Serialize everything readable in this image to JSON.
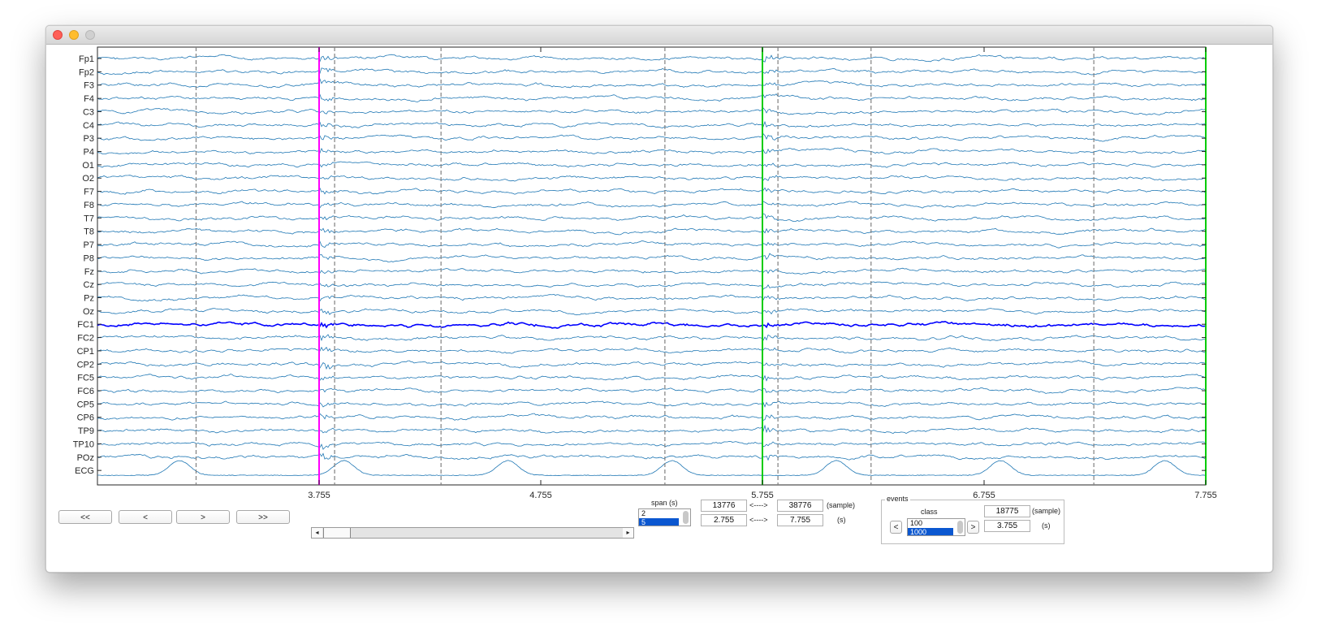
{
  "window": {
    "controls": [
      "close",
      "minimize",
      "maximize"
    ]
  },
  "chart_data": {
    "type": "line",
    "channels": [
      "Fp1",
      "Fp2",
      "F3",
      "F4",
      "C3",
      "C4",
      "P3",
      "P4",
      "O1",
      "O2",
      "F7",
      "F8",
      "T7",
      "T8",
      "P7",
      "P8",
      "Fz",
      "Cz",
      "Pz",
      "Oz",
      "FC1",
      "FC2",
      "CP1",
      "CP2",
      "FC5",
      "FC6",
      "CP5",
      "CP6",
      "TP9",
      "TP10",
      "POz",
      "ECG"
    ],
    "highlighted_channel": "FC1",
    "x_ticks": [
      "3.755",
      "4.755",
      "5.755",
      "6.755",
      "7.755"
    ],
    "xlim": [
      2.755,
      7.755
    ],
    "event_markers": [
      {
        "x": 3.755,
        "color": "#ff00ff"
      },
      {
        "x": 5.755,
        "color": "#00cc00"
      },
      {
        "x": 7.755,
        "color": "#00cc00"
      }
    ],
    "dashed_markers": [
      3.2,
      3.825,
      4.305,
      5.315,
      5.825,
      6.245,
      7.25
    ],
    "colors": {
      "trace": "#1f77b4",
      "highlight": "#0000ff",
      "dashed": "#808080"
    }
  },
  "nav": {
    "first": "<<",
    "prev": "<",
    "next": ">",
    "last": ">>"
  },
  "span": {
    "label": "span (s)",
    "options": [
      "2",
      "5"
    ],
    "selected": "5"
  },
  "range": {
    "sample_start": "13776",
    "sample_end": "38776",
    "time_start": "2.755",
    "time_end": "7.755",
    "arrow1": "<---->",
    "arrow2": "<---->",
    "unit_sample": "(sample)",
    "unit_time": "(s)"
  },
  "events": {
    "title": "events",
    "class_label": "class",
    "prev": "<",
    "next": ">",
    "classes": [
      "100",
      "1000"
    ],
    "selected": "1000",
    "sample": "18775",
    "time": "3.755",
    "unit_sample": "(sample)",
    "unit_time": "(s)"
  }
}
